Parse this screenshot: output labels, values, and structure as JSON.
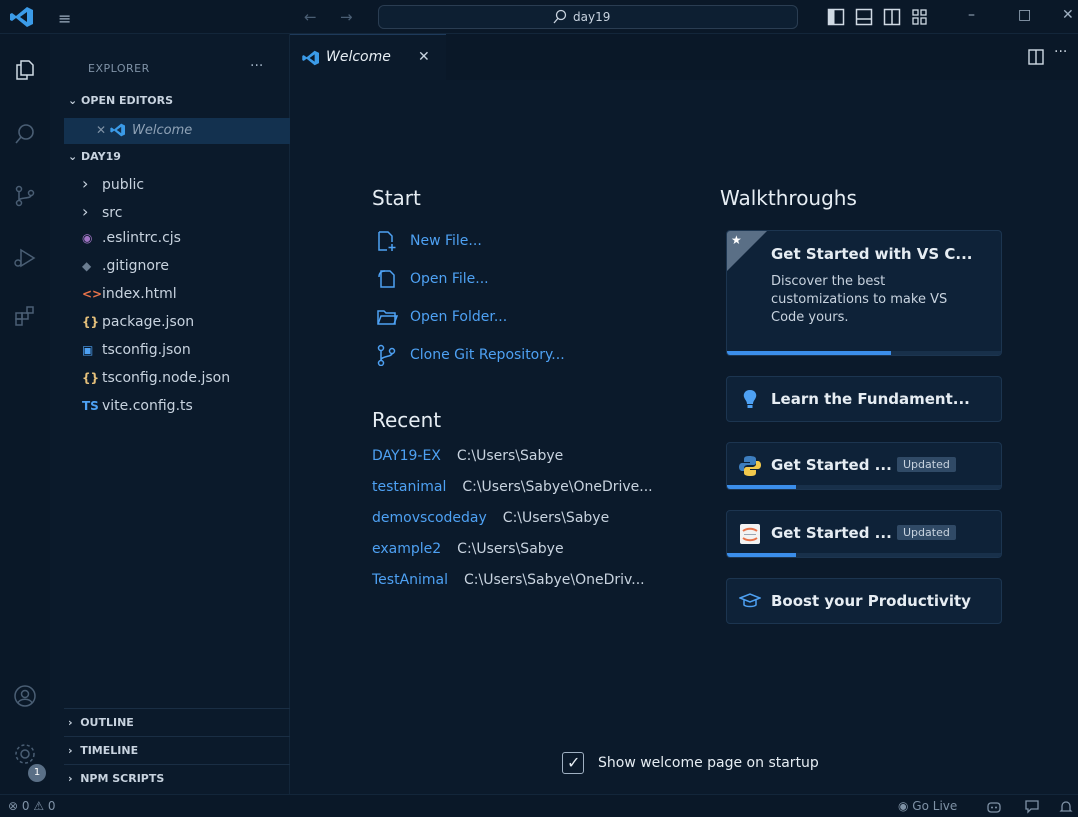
{
  "titlebar": {
    "search_text": "day19",
    "menu_glyph": "≡",
    "back_glyph": "←",
    "forward_glyph": "→",
    "minimize_glyph": "–",
    "maximize_glyph": "□",
    "close_glyph": "✕"
  },
  "sidebar": {
    "title": "EXPLORER",
    "more": "···",
    "open_editors_label": "OPEN EDITORS",
    "open_editors": [
      {
        "label": "Welcome",
        "icon": "vscode-icon"
      }
    ],
    "project_label": "DAY19",
    "tree": [
      {
        "label": "public",
        "type": "folder",
        "icon": "chevron-right-icon"
      },
      {
        "label": "src",
        "type": "folder",
        "icon": "chevron-right-icon"
      },
      {
        "label": ".eslintrc.cjs",
        "type": "file",
        "icon": "eslint-icon",
        "glyph": "◉",
        "color": "#a074c4"
      },
      {
        "label": ".gitignore",
        "type": "file",
        "icon": "git-icon",
        "glyph": "◆",
        "color": "#6b7d91"
      },
      {
        "label": "index.html",
        "type": "file",
        "icon": "html-icon",
        "glyph": "<>",
        "color": "#e8734a"
      },
      {
        "label": "package.json",
        "type": "file",
        "icon": "json-icon",
        "glyph": "{}",
        "color": "#e5c07b"
      },
      {
        "label": "tsconfig.json",
        "type": "file",
        "icon": "tsconfig-icon",
        "glyph": "▣",
        "color": "#4ea1f3"
      },
      {
        "label": "tsconfig.node.json",
        "type": "file",
        "icon": "json-icon",
        "glyph": "{}",
        "color": "#e5c07b"
      },
      {
        "label": "vite.config.ts",
        "type": "file",
        "icon": "typescript-icon",
        "glyph": "TS",
        "color": "#4ea1f3"
      }
    ],
    "bottom_sections": [
      "OUTLINE",
      "TIMELINE",
      "NPM SCRIPTS"
    ],
    "settings_badge": "1"
  },
  "tabs": [
    {
      "label": "Welcome",
      "close": "✕",
      "icon": "vscode-icon"
    }
  ],
  "tab_more": "···",
  "welcome": {
    "start_heading": "Start",
    "start_items": [
      {
        "label": "New File...",
        "icon": "new-file-icon"
      },
      {
        "label": "Open File...",
        "icon": "open-file-icon"
      },
      {
        "label": "Open Folder...",
        "icon": "open-folder-icon"
      },
      {
        "label": "Clone Git Repository...",
        "icon": "git-branch-icon"
      }
    ],
    "recent_heading": "Recent",
    "recent_items": [
      {
        "name": "DAY19-EX",
        "path": "C:\\Users\\Sabye"
      },
      {
        "name": "testanimal",
        "path": "C:\\Users\\Sabye\\OneDrive..."
      },
      {
        "name": "demovscodeday",
        "path": "C:\\Users\\Sabye"
      },
      {
        "name": "example2",
        "path": "C:\\Users\\Sabye"
      },
      {
        "name": "TestAnimal",
        "path": "C:\\Users\\Sabye\\OneDriv..."
      }
    ],
    "walkthroughs_heading": "Walkthroughs",
    "walkthroughs": [
      {
        "title": "Get Started with VS C...",
        "description": "Discover the best customizations to make VS Code yours.",
        "icon": "star-icon",
        "progress": 0.6,
        "featured": true
      },
      {
        "title": "Learn the Fundament...",
        "icon": "lightbulb-icon",
        "progress": null
      },
      {
        "title": "Get Started ...",
        "badge": "Updated",
        "icon": "python-icon",
        "progress": 0.25
      },
      {
        "title": "Get Started ...",
        "badge": "Updated",
        "icon": "jupyter-icon",
        "progress": 0.25
      },
      {
        "title": "Boost your Productivity",
        "icon": "mortarboard-icon",
        "progress": null
      }
    ],
    "show_on_startup_label": "Show welcome page on startup",
    "show_on_startup_checked": true
  },
  "statusbar": {
    "problems": "⊗ 0 ⚠ 0",
    "go_live": "Go Live"
  },
  "colors": {
    "accent": "#3b8eea",
    "link": "#4ea1f3",
    "background": "#0b1a2b"
  }
}
